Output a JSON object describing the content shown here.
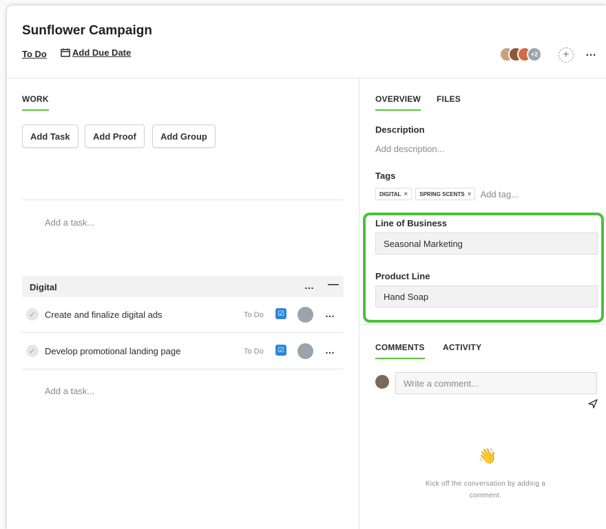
{
  "header": {
    "title": "Sunflower Campaign",
    "status": "To Do",
    "due_date": "Add Due Date",
    "extra_members": "+2",
    "add_member": "+",
    "more": "…"
  },
  "work": {
    "tab_label": "WORK",
    "buttons": {
      "add_task": "Add Task",
      "add_proof": "Add Proof",
      "add_group": "Add Group"
    },
    "add_task_placeholder": "Add a task...",
    "group": {
      "name": "Digital",
      "more": "…",
      "collapse": "—",
      "tasks": [
        {
          "name": "Create and finalize digital ads",
          "status": "To Do",
          "more": "…"
        },
        {
          "name": "Develop promotional landing page",
          "status": "To Do",
          "more": "…"
        }
      ],
      "add_task_placeholder": "Add a task..."
    }
  },
  "sidebar": {
    "tabs": {
      "overview": "OVERVIEW",
      "files": "FILES"
    },
    "description_label": "Description",
    "description_placeholder": "Add description...",
    "tags_label": "Tags",
    "tags": [
      {
        "label": "DIGITAL",
        "remove": "×"
      },
      {
        "label": "SPRING SCENTS",
        "remove": "×"
      }
    ],
    "tag_placeholder": "Add tag...",
    "custom_fields": {
      "line_of_business_label": "Line of Business",
      "line_of_business_value": "Seasonal Marketing",
      "product_line_label": "Product Line",
      "product_line_value": "Hand Soap"
    },
    "comment_tabs": {
      "comments": "COMMENTS",
      "activity": "ACTIVITY"
    },
    "comment_placeholder": "Write a comment...",
    "empty_emoji": "👋",
    "empty_text": "Kick off the conversation by adding a comment."
  },
  "colors": {
    "accent_green": "#5ac23a",
    "highlight_green": "#49c23a",
    "task_type_blue": "#2f86d6"
  }
}
